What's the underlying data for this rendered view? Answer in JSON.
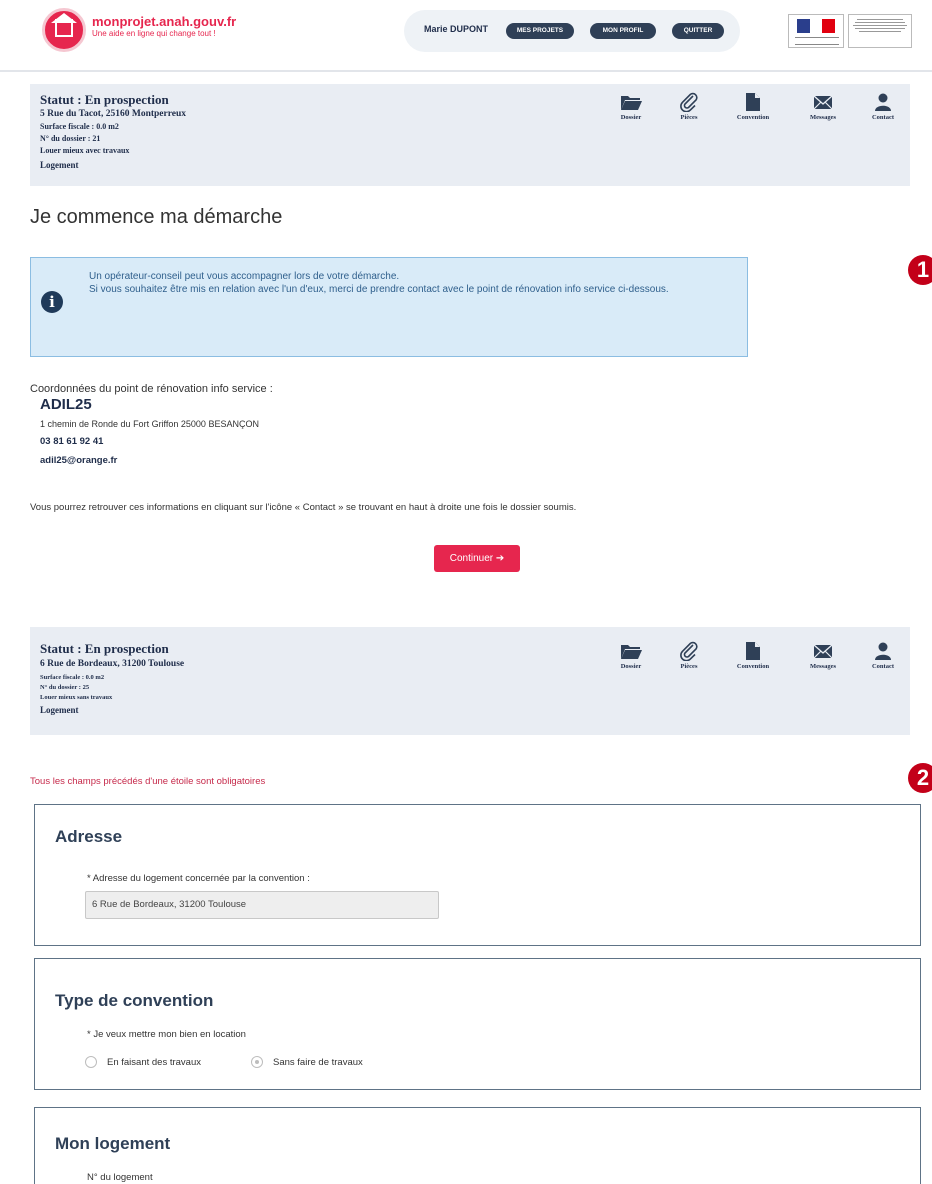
{
  "header": {
    "brand_name": "monprojet.anah.gouv.fr",
    "brand_tagline": "Une aide en ligne qui change tout !",
    "user_name": "Marie DUPONT",
    "btn_projects": "MES PROJETS",
    "btn_profile": "MON PROFIL",
    "btn_quit": "QUITTER"
  },
  "status1": {
    "title": "Statut : En prospection",
    "address": "5 Rue du Tacot, 25160 Montperreux",
    "surface": "Surface fiscale : 0.0 m2",
    "dossier": "N° du dossier : 21",
    "type": "Louer mieux avec travaux",
    "logement": "Logement"
  },
  "status2": {
    "title": "Statut : En prospection",
    "address": "6 Rue de Bordeaux, 31200 Toulouse",
    "surface": "Surface fiscale : 0.0 m2",
    "dossier": "N° du dossier : 25",
    "type": "Louer mieux sans travaux",
    "logement": "Logement"
  },
  "nav": {
    "dossier": "Dossier",
    "pieces": "Pièces",
    "convention": "Convention",
    "messages": "Messages",
    "contact": "Contact"
  },
  "main": {
    "heading": "Je commence ma démarche",
    "info_line1": "Un opérateur-conseil peut vous accompagner lors de votre démarche.",
    "info_line2": "Si vous souhaitez être mis en relation avec l'un d'eux, merci de prendre contact avec le point de rénovation info service ci-dessous.",
    "coord_label": "Coordonnées du point de rénovation info service :",
    "adil_name": "ADIL25",
    "adil_address": "1 chemin de Ronde du Fort Griffon 25000 BESANÇON",
    "adil_phone": "03 81 61 92 41",
    "adil_email": "adil25@orange.fr",
    "retrouver": "Vous pourrez retrouver ces informations en cliquant sur l'icône « Contact » se trouvant en haut à droite une fois le dossier soumis.",
    "continue_label": "Continuer ➔"
  },
  "badges": {
    "one": "1",
    "two": "2"
  },
  "form": {
    "required_note": "Tous les champs précédés d'une étoile sont obligatoires",
    "adresse_title": "Adresse",
    "adresse_label": "* Adresse du logement concernée par la convention :",
    "adresse_value": "6 Rue de Bordeaux, 31200 Toulouse",
    "type_title": "Type de convention",
    "type_label": "* Je veux mettre mon bien en location",
    "option_with": "En faisant des travaux",
    "option_without": "Sans faire de travaux",
    "option_selected": "Sans faire de travaux",
    "logement_title": "Mon logement",
    "logement_label": "N° du logement"
  },
  "colors": {
    "brand": "#e6264e",
    "navy": "#1f2d4a",
    "panel": "#e9edf3",
    "info_bg": "#d9ebf8",
    "badge": "#c30019"
  }
}
